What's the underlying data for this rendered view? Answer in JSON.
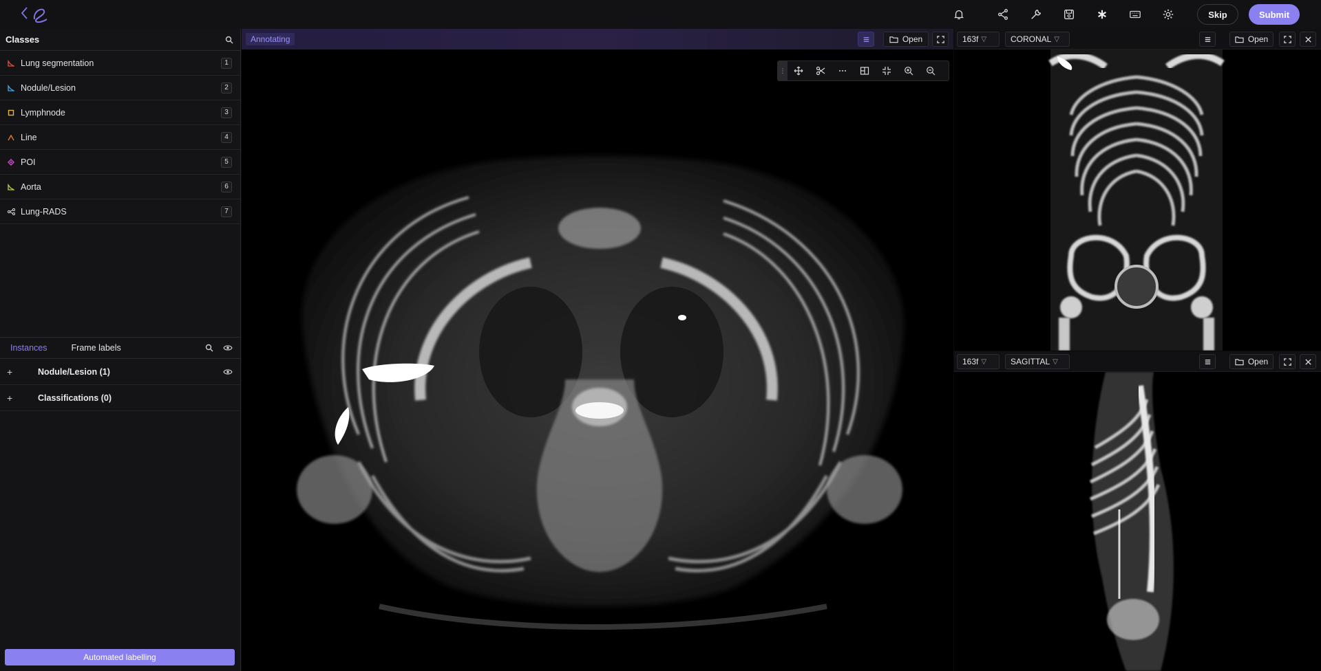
{
  "header": {
    "skip_label": "Skip",
    "submit_label": "Submit",
    "icons": [
      "back-chevron-icon",
      "bell-icon",
      "share-icon",
      "wrench-icon",
      "save-icon",
      "asterisk-icon",
      "keyboard-icon",
      "gear-icon",
      "moon-icon"
    ]
  },
  "classes": {
    "title": "Classes",
    "items": [
      {
        "label": "Lung segmentation",
        "key": "1",
        "color": "#e0533d",
        "icon": "polygon-icon"
      },
      {
        "label": "Nodule/Lesion",
        "key": "2",
        "color": "#3fa9e6",
        "icon": "polygon-icon"
      },
      {
        "label": "Lymphnode",
        "key": "3",
        "color": "#e9b53a",
        "icon": "box-icon"
      },
      {
        "label": "Line",
        "key": "4",
        "color": "#e47a2c",
        "icon": "polyline-icon"
      },
      {
        "label": "POI",
        "key": "5",
        "color": "#d34bd6",
        "icon": "point-icon"
      },
      {
        "label": "Aorta",
        "key": "6",
        "color": "#b9d43a",
        "icon": "polygon-icon"
      },
      {
        "label": "Lung-RADS",
        "key": "7",
        "color": "#cfcfcf",
        "icon": "classification-icon"
      }
    ]
  },
  "instances": {
    "tab_instances": "Instances",
    "tab_frame_labels": "Frame labels",
    "rows": [
      {
        "label": "Nodule/Lesion (1)"
      },
      {
        "label": "Classifications (0)"
      }
    ]
  },
  "automated_labelling_label": "Automated labelling",
  "main_view": {
    "status": "Annotating",
    "open_label": "Open"
  },
  "coronal_view": {
    "frame": "163f",
    "plane": "CORONAL",
    "open_label": "Open"
  },
  "sagittal_view": {
    "frame": "163f",
    "plane": "SAGITTAL",
    "open_label": "Open"
  }
}
